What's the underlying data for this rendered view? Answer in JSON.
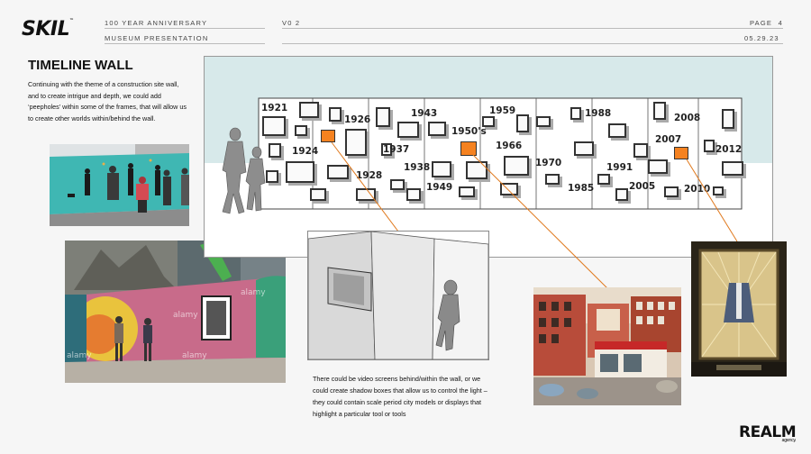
{
  "header": {
    "brand": "SKIL",
    "brand_mark": "™",
    "subtitle_1": "100 YEAR ANNIVERSARY",
    "subtitle_2": "MUSEUM PRESENTATION",
    "version": "V0 2",
    "page_label": "PAGE",
    "page_number": "4",
    "date": "05.29.23"
  },
  "main": {
    "title": "TIMELINE WALL",
    "description": "Continuing with the theme of a construction site wall, and to create intrigue and depth, we could add ‘peepholes’ within some of the frames, that will allow us to create other worlds within/behind the wall.",
    "caption": "There could be video screens behind/within the wall, or we could create shadow boxes that allow us to control the light – they could contain scale period city models or displays that highlight a particular tool or tools"
  },
  "timeline": {
    "years": [
      "1921",
      "1926",
      "1924",
      "1928",
      "1937",
      "1938",
      "1943",
      "1949",
      "1950's",
      "1959",
      "1966",
      "1970",
      "1985",
      "1988",
      "1991",
      "2005",
      "2007",
      "2008",
      "2010",
      "2012"
    ]
  },
  "watermarks": {
    "stock": "alamy"
  },
  "footer": {
    "agency": "REALM",
    "agency_sub": "agency."
  },
  "colors": {
    "accent": "#f58220",
    "teal_wall": "#3fb7b3",
    "sky": "#d7e9ea"
  }
}
